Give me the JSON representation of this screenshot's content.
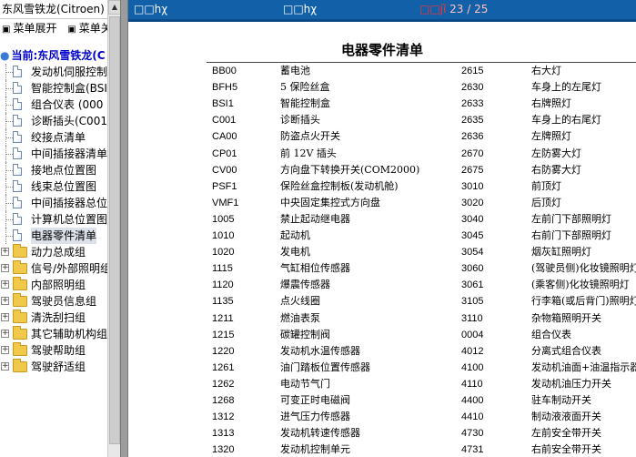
{
  "left_pane": {
    "title": "东风雪铁龙(Citroen)",
    "menu": {
      "expand": "菜单展开",
      "collapse": "菜单关"
    },
    "root": "当前:东风雪铁龙(C",
    "docs": [
      {
        "label": "发动机伺服控制"
      },
      {
        "label": "智能控制盒(BSI"
      },
      {
        "label": "组合仪表 (000"
      },
      {
        "label": "诊断插头(C001"
      },
      {
        "label": "绞接点清单"
      },
      {
        "label": "中间插接器清单"
      },
      {
        "label": "接地点位置图"
      },
      {
        "label": "线束总位置图"
      },
      {
        "label": "中间插接器总位"
      },
      {
        "label": "计算机总位置图"
      },
      {
        "label": "电器零件清单",
        "selected": true
      }
    ],
    "folders": [
      {
        "label": "动力总成组"
      },
      {
        "label": "信号/外部照明组"
      },
      {
        "label": "内部照明组"
      },
      {
        "label": "驾驶员信息组"
      },
      {
        "label": "清洗刮扫组"
      },
      {
        "label": "其它辅助机构组"
      },
      {
        "label": "驾驶帮助组"
      },
      {
        "label": "驾驶舒适组"
      }
    ]
  },
  "toolbar": {
    "btn1": "□□hχ",
    "btn2": "□□hχ",
    "page_prefix": "□□jĭ",
    "page_current": "23",
    "page_sep": "/",
    "page_total": "25"
  },
  "document": {
    "title": "电器零件清单",
    "rows": [
      {
        "code1": "BB00",
        "name1": "蓄电池",
        "code2": "2615",
        "name2": "右大灯"
      },
      {
        "code1": "BFH5",
        "name1": "5 保险丝盒",
        "code2": "2630",
        "name2": "车身上的左尾灯"
      },
      {
        "code1": "BSI1",
        "name1": "智能控制盒",
        "code2": "2633",
        "name2": "右牌照灯"
      },
      {
        "code1": "C001",
        "name1": "诊断插头",
        "code2": "2635",
        "name2": "车身上的右尾灯"
      },
      {
        "code1": "CA00",
        "name1": "防盗点火开关",
        "code2": "2636",
        "name2": "左牌照灯"
      },
      {
        "code1": "CP01",
        "name1": "前 12V 插头",
        "code2": "2670",
        "name2": "左防雾大灯"
      },
      {
        "code1": "CV00",
        "name1": "方向盘下转换开关(COM2000)",
        "code2": "2675",
        "name2": "右防雾大灯"
      },
      {
        "code1": "PSF1",
        "name1": "保险丝盒控制板(发动机舱)",
        "code2": "3010",
        "name2": "前顶灯"
      },
      {
        "code1": "VMF1",
        "name1": "中央固定集控式方向盘",
        "code2": "3020",
        "name2": "后顶灯"
      },
      {
        "code1": "1005",
        "name1": "禁止起动继电器",
        "code2": "3040",
        "name2": "左前门下部照明灯"
      },
      {
        "code1": "1010",
        "name1": "起动机",
        "code2": "3045",
        "name2": "右前门下部照明灯"
      },
      {
        "code1": "1020",
        "name1": "发电机",
        "code2": "3054",
        "name2": "烟灰缸照明灯"
      },
      {
        "code1": "1115",
        "name1": "气缸相位传感器",
        "code2": "3060",
        "name2": "(驾驶员侧)化妆镜照明灯"
      },
      {
        "code1": "1120",
        "name1": "爆震传感器",
        "code2": "3061",
        "name2": "(乘客侧)化妆镜照明灯"
      },
      {
        "code1": "1135",
        "name1": "点火线圈",
        "code2": "3105",
        "name2": "行李箱(或后背门)照明灯"
      },
      {
        "code1": "1211",
        "name1": "燃油表泵",
        "code2": "3110",
        "name2": "杂物箱照明开关"
      },
      {
        "code1": "1215",
        "name1": "碳罐控制阀",
        "code2": "0004",
        "name2": "组合仪表"
      },
      {
        "code1": "1220",
        "name1": "发动机水温传感器",
        "code2": "4012",
        "name2": "分离式组合仪表"
      },
      {
        "code1": "1261",
        "name1": "油门踏板位置传感器",
        "code2": "4100",
        "name2": "发动机油面+油温指示器"
      },
      {
        "code1": "1262",
        "name1": "电动节气门",
        "code2": "4110",
        "name2": "发动机油压力开关"
      },
      {
        "code1": "1268",
        "name1": "可变正时电磁阀",
        "code2": "4400",
        "name2": "驻车制动开关"
      },
      {
        "code1": "1312",
        "name1": "进气压力传感器",
        "code2": "4410",
        "name2": "制动液液面开关"
      },
      {
        "code1": "1313",
        "name1": "发动机转速传感器",
        "code2": "4730",
        "name2": "左前安全带开关"
      },
      {
        "code1": "1320",
        "name1": "发动机控制单元",
        "code2": "4731",
        "name2": "右前安全带开关"
      }
    ]
  }
}
